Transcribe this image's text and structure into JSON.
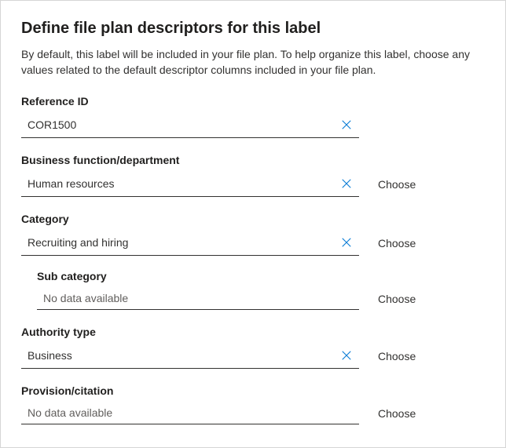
{
  "title": "Define file plan descriptors for this label",
  "description": "By default, this label will be included in your file plan. To help organize this label, choose any values related to the default descriptor columns included in your file plan.",
  "common": {
    "choose": "Choose",
    "no_data": "No data available"
  },
  "fields": {
    "reference_id": {
      "label": "Reference ID",
      "value": "COR1500"
    },
    "business_function": {
      "label": "Business function/department",
      "value": "Human resources"
    },
    "category": {
      "label": "Category",
      "value": "Recruiting and hiring"
    },
    "sub_category": {
      "label": "Sub category"
    },
    "authority_type": {
      "label": "Authority type",
      "value": "Business"
    },
    "provision_citation": {
      "label": "Provision/citation"
    }
  }
}
